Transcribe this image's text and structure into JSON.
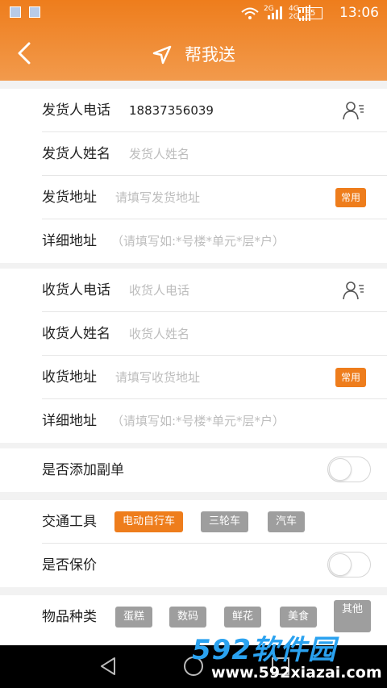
{
  "status_bar": {
    "time": "13:06",
    "battery": "85",
    "signal_a": "2G",
    "signal_b": "4G",
    "signal_c": "2G"
  },
  "header": {
    "title": "帮我送"
  },
  "sender": {
    "phone_label": "发货人电话",
    "phone_value": "18837356039",
    "name_label": "发货人姓名",
    "name_placeholder": "发货人姓名",
    "address_label": "发货地址",
    "address_placeholder": "请填写发货地址",
    "address_tag": "常用",
    "detail_label": "详细地址",
    "detail_placeholder": "（请填写如:*号楼*单元*层*户）"
  },
  "receiver": {
    "phone_label": "收货人电话",
    "phone_placeholder": "收货人电话",
    "name_label": "收货人姓名",
    "name_placeholder": "收货人姓名",
    "address_label": "收货地址",
    "address_placeholder": "请填写收货地址",
    "address_tag": "常用",
    "detail_label": "详细地址",
    "detail_placeholder": "（请填写如:*号楼*单元*层*户）"
  },
  "extra": {
    "copy_label": "是否添加副单",
    "copy_on": false
  },
  "transport": {
    "label": "交通工具",
    "options": [
      "电动自行车",
      "三轮车",
      "汽车"
    ],
    "selected": "电动自行车",
    "insure_label": "是否保价",
    "insure_on": false
  },
  "goods": {
    "label": "物品种类",
    "options": [
      "蛋糕",
      "数码",
      "鲜花",
      "美食",
      "其他"
    ]
  },
  "watermark": {
    "line1": "592软件园",
    "line2": "www.592xiazai.com"
  },
  "colors": {
    "accent": "#ee7d1c",
    "chip_gray": "#9e9e9e",
    "bg": "#f2f2f2"
  }
}
